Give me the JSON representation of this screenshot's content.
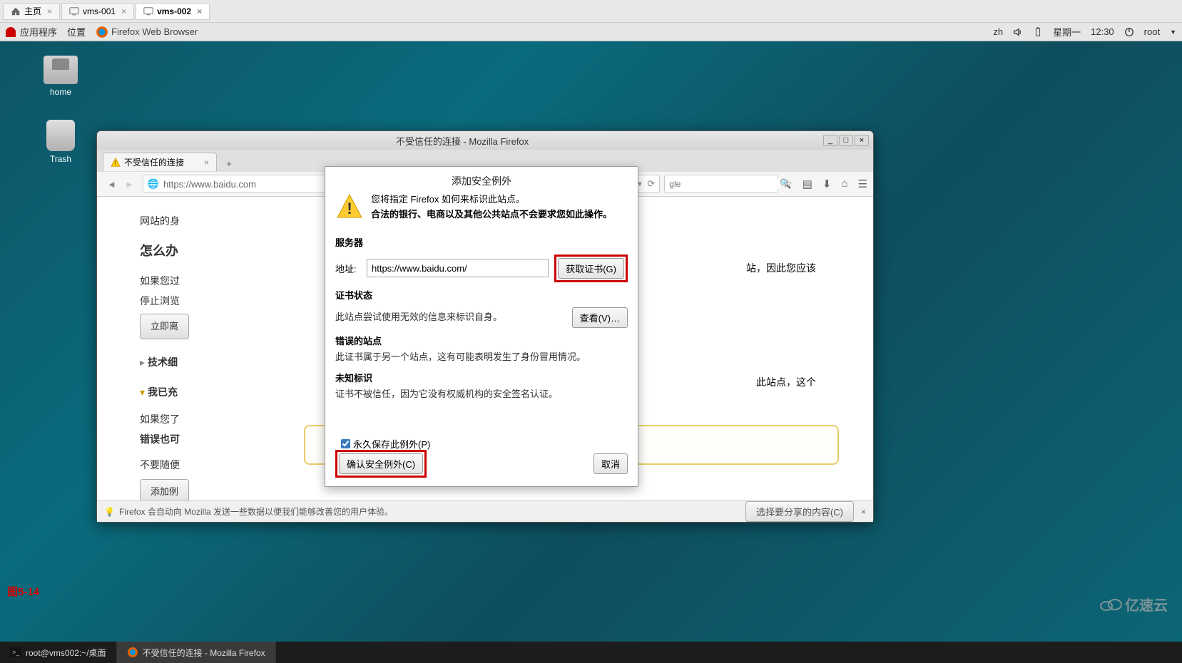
{
  "webtabs": {
    "home": "主页",
    "t1": "vms-001",
    "t2": "vms-002"
  },
  "gnome": {
    "apps": "应用程序",
    "places": "位置",
    "ff": "Firefox Web Browser",
    "lang": "zh",
    "day": "星期一",
    "time": "12:30",
    "user": "root"
  },
  "desktop": {
    "home": "home",
    "trash": "Trash"
  },
  "ffwin": {
    "title": "不受信任的连接  -  Mozilla Firefox",
    "tab": "不受信任的连接",
    "url": "https://www.baidu.com",
    "search_ph": "gle",
    "bg": {
      "line1": "网站的身",
      "h1": "怎么办",
      "line2": "如果您过",
      "line3": "停止浏览",
      "btn1": "立即离",
      "tech": "技术细",
      "trust": "我已充",
      "line4a": "如果您了",
      "line4b": "错误也可",
      "line5": "不要随便",
      "btn2": "添加例",
      "right1": "站，因此您应该",
      "right2": "此站点，这个"
    },
    "status": "Firefox 会自动向 Mozilla 发送一些数据以便我们能够改善您的用户体验。",
    "status_btn": "选择要分享的内容(C)"
  },
  "dialog": {
    "title": "添加安全例外",
    "line1": "您将指定 Firefox 如何来标识此站点。",
    "line2": "合法的银行、电商以及其他公共站点不会要求您如此操作。",
    "server": "服务器",
    "addr_label": "地址:",
    "addr_value": "https://www.baidu.com/",
    "get_cert": "获取证书(G)",
    "cert_status": "证书状态",
    "cert_status_text": "此站点尝试使用无效的信息来标识自身。",
    "view": "查看(V)…",
    "wrong_site": "错误的站点",
    "wrong_site_text": "此证书属于另一个站点，这有可能表明发生了身份冒用情况。",
    "unknown": "未知标识",
    "unknown_text": "证书不被信任，因为它没有权威机构的安全签名认证。",
    "save_perm": "永久保存此例外(P)",
    "confirm": "确认安全例外(C)",
    "cancel": "取消"
  },
  "figure": "图5-14",
  "watermark": "亿速云",
  "taskbar": {
    "term": "root@vms002:~/桌面",
    "ff": "不受信任的连接 - Mozilla Firefox"
  }
}
